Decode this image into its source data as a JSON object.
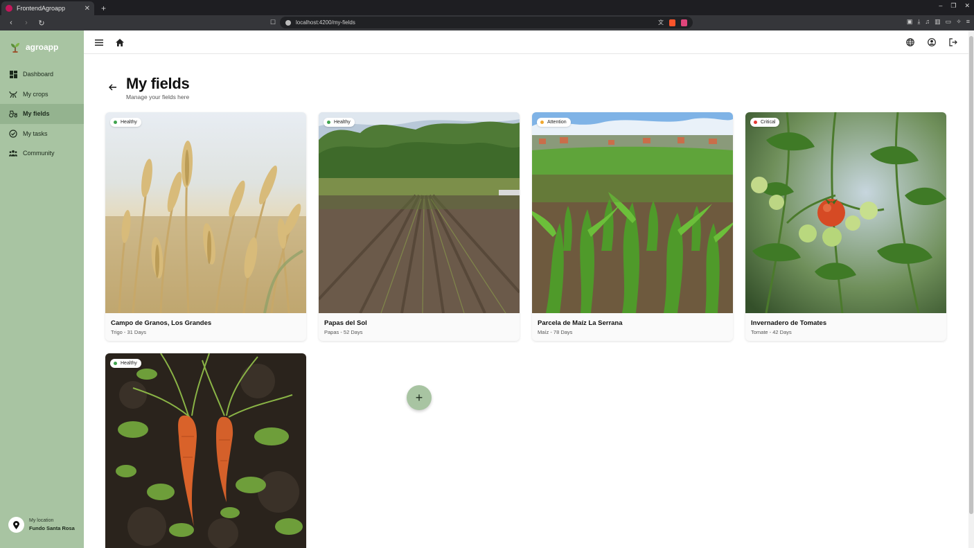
{
  "browser": {
    "tab_title": "FrontendAgroapp",
    "tab_close": "✕",
    "new_tab": "+",
    "url": "localhost:4200/my-fields"
  },
  "app": {
    "name": "agroapp"
  },
  "sidebar": {
    "items": [
      {
        "label": "Dashboard",
        "icon": "dashboard-icon",
        "active": false
      },
      {
        "label": "My crops",
        "icon": "sprout-icon",
        "active": false
      },
      {
        "label": "My fields",
        "icon": "tractor-icon",
        "active": true
      },
      {
        "label": "My tasks",
        "icon": "check-circle-icon",
        "active": false
      },
      {
        "label": "Community",
        "icon": "people-icon",
        "active": false
      }
    ],
    "location": {
      "label": "My location",
      "value": "Fundo Santa Rosa"
    }
  },
  "page": {
    "title": "My fields",
    "subtitle": "Manage your fields here"
  },
  "fields": [
    {
      "name": "Campo de Granos, Los Grandes",
      "info": "Trigo - 31 Days",
      "status": "Healthy",
      "status_color": "#3fa34d",
      "image": "wheat"
    },
    {
      "name": "Papas del Sol",
      "info": "Papas - 52 Days",
      "status": "Healthy",
      "status_color": "#3fa34d",
      "image": "plowed-field"
    },
    {
      "name": "Parcela de Maíz La Serrana",
      "info": "Maíz - 78 Days",
      "status": "Attention",
      "status_color": "#f0a830",
      "image": "corn"
    },
    {
      "name": "Invernadero de Tomates",
      "info": "Tomate - 42 Days",
      "status": "Critical",
      "status_color": "#e53935",
      "image": "tomatoes"
    },
    {
      "name": "",
      "info": "",
      "status": "Healthy",
      "status_color": "#3fa34d",
      "image": "carrots"
    }
  ],
  "add_button": {
    "label": "+"
  },
  "colors": {
    "sidebar_bg": "#a8c4a2",
    "sidebar_active": "#94b38f",
    "accent": "#a8c4a2"
  }
}
